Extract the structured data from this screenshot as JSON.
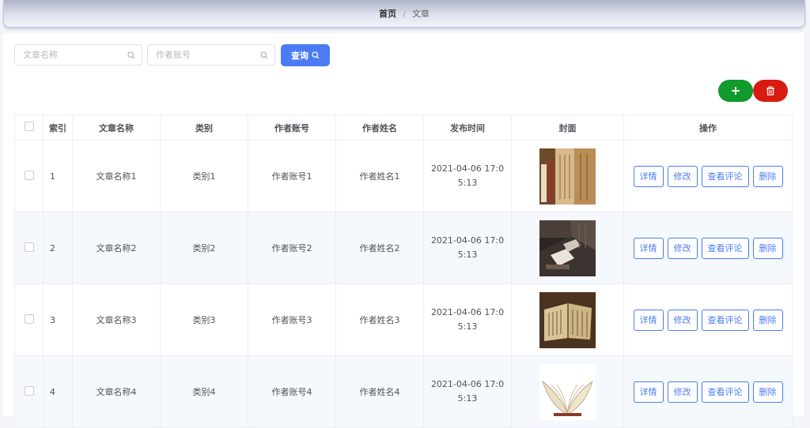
{
  "breadcrumb": {
    "home": "首页",
    "separator": "/",
    "current": "文章"
  },
  "search": {
    "title_placeholder": "文章名称",
    "account_placeholder": "作者账号",
    "query_label": "查询"
  },
  "table": {
    "headers": [
      "索引",
      "文章名称",
      "类别",
      "作者账号",
      "作者姓名",
      "发布时间",
      "封面",
      "操作"
    ],
    "rows": [
      {
        "index": "1",
        "title": "文章名称1",
        "category": "类别1",
        "account": "作者账号1",
        "author": "作者姓名1",
        "time": "2021-04-06 17:05:13",
        "cover": "bookshelf"
      },
      {
        "index": "2",
        "title": "文章名称2",
        "category": "类别2",
        "account": "作者账号2",
        "author": "作者姓名2",
        "time": "2021-04-06 17:05:13",
        "cover": "library-reading"
      },
      {
        "index": "3",
        "title": "文章名称3",
        "category": "类别3",
        "account": "作者账号3",
        "author": "作者姓名3",
        "time": "2021-04-06 17:05:13",
        "cover": "ancient-book"
      },
      {
        "index": "4",
        "title": "文章名称4",
        "category": "类别4",
        "account": "作者账号4",
        "author": "作者姓名4",
        "time": "2021-04-06 17:05:13",
        "cover": "open-book"
      }
    ],
    "actions": {
      "detail": "详情",
      "edit": "修改",
      "comments": "查看评论",
      "delete": "删除"
    }
  },
  "colors": {
    "primary": "#4b7cf5",
    "add": "#109a2b",
    "danger": "#d91a10"
  },
  "icons": {
    "search": "magnifier-icon",
    "add": "plus-icon",
    "delete": "trash-icon"
  }
}
